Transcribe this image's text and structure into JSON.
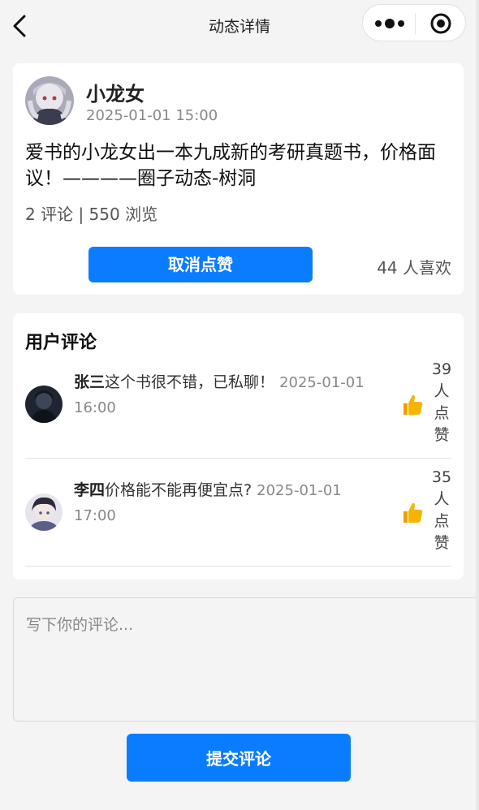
{
  "nav": {
    "title": "动态详情"
  },
  "post": {
    "author": "小龙女",
    "time": "2025-01-01 15:00",
    "content": "爱书的小龙女出一本九成新的考研真题书，价格面议！————圈子动态-树洞",
    "stats": "2 评论 | 550 浏览",
    "unlike_label": "取消点赞",
    "like_count_text": "44 人喜欢"
  },
  "comments_section": {
    "title": "用户评论",
    "items": [
      {
        "user": "张三",
        "text": "这个书很不错，已私聊！",
        "time": "2025-01-01 16:00",
        "likes_text": "39人点赞"
      },
      {
        "user": "李四",
        "text": "价格能不能再便宜点?",
        "time": "2025-01-01 17:00",
        "likes_text": "35人点赞"
      }
    ]
  },
  "input": {
    "placeholder": "写下你的评论..."
  },
  "submit_label": "提交评论",
  "colors": {
    "accent": "#0a7cff",
    "background": "#f4f4f4",
    "thumb": "#f5b400"
  },
  "icons": [
    "back-icon",
    "more-icon",
    "target-icon",
    "thumbs-up-icon"
  ]
}
